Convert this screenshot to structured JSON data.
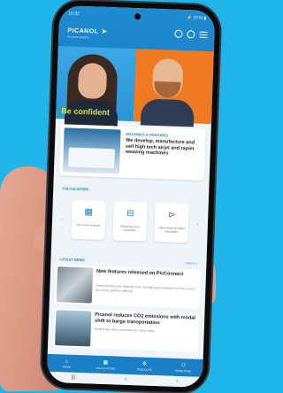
{
  "status_bar": {
    "time": "10:32",
    "right": "⚡ 87% ▮"
  },
  "header": {
    "brand": "PICANOL",
    "tagline": "let's grow together"
  },
  "hero": {
    "slogan": "Be confident"
  },
  "machines_card": {
    "label": "MACHINES & FEATURES",
    "text": "We develop, manufacture and sell high tech airjet and rapier weaving machines"
  },
  "calculators": {
    "title": "CALCULATORS",
    "items": [
      {
        "label": "Yarn count converter",
        "icon": "▦"
      },
      {
        "label": "Remaining warp calculation",
        "icon": "⊟"
      },
      {
        "label": "Fabric length & weight calculation",
        "icon": "⊳"
      }
    ]
  },
  "latest_news": {
    "title": "LATEST NEWS",
    "view_all": "VIEW ALL",
    "items": [
      {
        "title": "New features released on PicConnect",
        "desc": "Some exciting new features have recently been released on PicConnect, our online platform offering"
      },
      {
        "title": "Picanol reduces CO2 emissions with modal shift to barge transportation",
        "desc": "Picanol has been committed for many years"
      }
    ]
  },
  "bottom_nav": [
    {
      "label": "HOME",
      "icon": "⌂"
    },
    {
      "label": "CALCULATORS",
      "icon": "▦"
    },
    {
      "label": "PRODUCTS",
      "icon": "⚙"
    },
    {
      "label": "PICNETTING",
      "icon": "⚇"
    }
  ],
  "system_nav": {
    "recents": "|||",
    "home": "○",
    "back": "‹"
  }
}
